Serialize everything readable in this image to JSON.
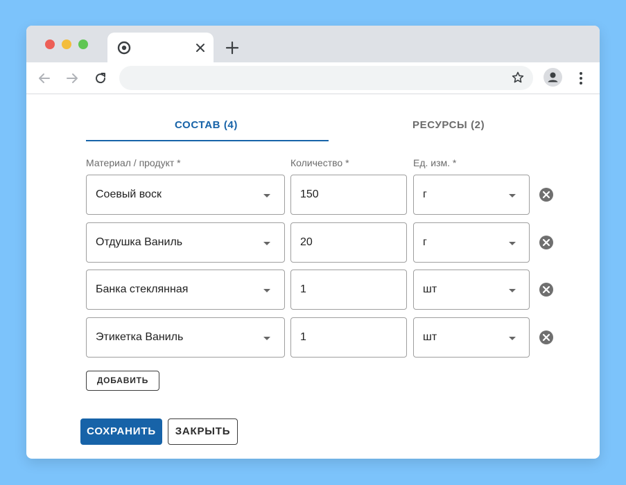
{
  "tabs": [
    {
      "label": "СОСТАВ (4)",
      "active": true
    },
    {
      "label": "РЕСУРСЫ (2)",
      "active": false
    }
  ],
  "columns": {
    "material": "Материал / продукт *",
    "quantity": "Количество *",
    "unit": "Ед. изм. *"
  },
  "rows": [
    {
      "material": "Соевый воск",
      "quantity": "150",
      "unit": "г"
    },
    {
      "material": "Отдушка Ваниль",
      "quantity": "20",
      "unit": "г"
    },
    {
      "material": "Банка стеклянная",
      "quantity": "1",
      "unit": "шт"
    },
    {
      "material": "Этикетка Ваниль",
      "quantity": "1",
      "unit": "шт"
    }
  ],
  "buttons": {
    "add": "ДОБАВИТЬ",
    "save": "СОХРАНИТЬ",
    "close": "ЗАКРЫТЬ"
  },
  "browser": {
    "address": ""
  },
  "colors": {
    "accent": "#1763a8",
    "background": "#7cc3fb"
  }
}
